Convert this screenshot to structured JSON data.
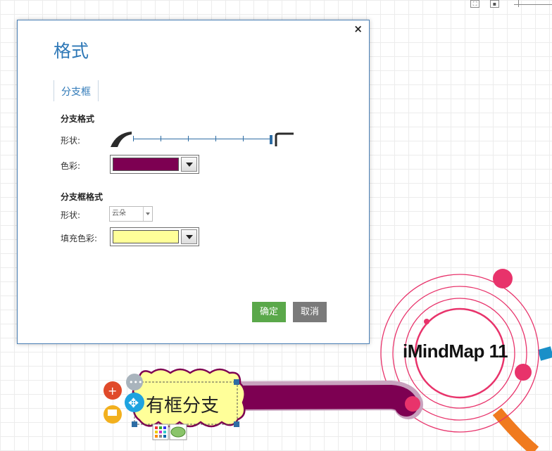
{
  "dialog": {
    "title": "格式",
    "close_glyph": "×",
    "tab_label": "分支框",
    "branch_section": {
      "heading": "分支格式",
      "shape_label": "形状:",
      "color_label": "色彩:",
      "color_value": "#7d0052",
      "shape_start_icon": "curved-tapered-branch-icon",
      "shape_end_icon": "angular-branch-icon"
    },
    "frame_section": {
      "heading": "分支框格式",
      "shape_label": "形状:",
      "shape_value": "云朵",
      "fill_label": "填充色彩:",
      "fill_value": "#ffff99"
    },
    "ok_label": "确定",
    "cancel_label": "取消"
  },
  "canvas": {
    "central_idea": "iMindMap 11",
    "branch_label": "有框分支",
    "branch_color": "#7d0052",
    "frame_fill": "#ffff99",
    "ring_color": "#e8336b",
    "icons": [
      "add-branch-icon",
      "more-options-icon",
      "move-icon",
      "add-note-icon",
      "color-palette-icon",
      "frame-shape-icon"
    ]
  },
  "toolbar": {
    "icons": [
      "fit-screen-icon",
      "page-icon",
      "zoom-slider"
    ]
  }
}
